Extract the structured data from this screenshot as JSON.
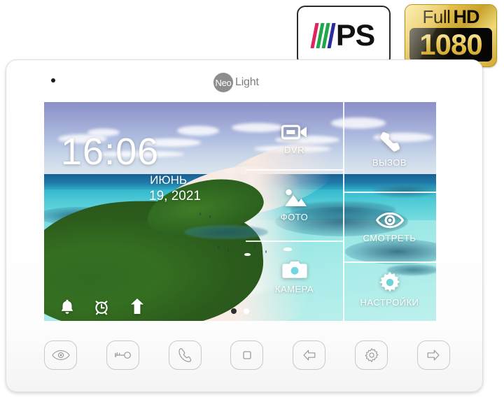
{
  "badges": {
    "ips": {
      "text": "PS",
      "bar_colors": [
        "#e0245e",
        "#1fa84a",
        "#1fa84a",
        "#2b2b9e"
      ],
      "name": "ips-badge"
    },
    "full_hd": {
      "full": "Full",
      "hd": "HD",
      "resolution": "1080",
      "gold": "#e8c552"
    }
  },
  "device": {
    "brand_mark": "Neo",
    "brand_word": "Light"
  },
  "screen": {
    "clock": {
      "time": "16:06",
      "month": "ИЮНЬ",
      "date": "19, 2021"
    },
    "status_icons": [
      {
        "name": "bell-icon",
        "label": "bell"
      },
      {
        "name": "alarm-clock-icon",
        "label": "alarm"
      },
      {
        "name": "upload-arrow-icon",
        "label": "upload"
      }
    ],
    "menu_tiles": [
      {
        "id": "dvr",
        "label": "DVR",
        "icon": "video-camera-icon"
      },
      {
        "id": "photo",
        "label": "ФОТО",
        "icon": "photo-icon"
      },
      {
        "id": "camera",
        "label": "КАМЕРА",
        "icon": "camera-icon"
      },
      {
        "id": "call",
        "label": "ВЫЗОВ",
        "icon": "phone-icon"
      },
      {
        "id": "watch",
        "label": "СМОТРЕТЬ",
        "icon": "eye-icon"
      },
      {
        "id": "settings",
        "label": "НАСТРОЙКИ",
        "icon": "gear-icon"
      }
    ],
    "pager": {
      "total": 2,
      "active": 2
    }
  },
  "touch_buttons": [
    {
      "id": "monitor",
      "icon": "eye-icon",
      "label": "Monitor"
    },
    {
      "id": "unlock",
      "icon": "key-icon",
      "label": "Unlock"
    },
    {
      "id": "talk",
      "icon": "phone-handset-icon",
      "label": "Talk"
    },
    {
      "id": "stop",
      "icon": "square-stop-icon",
      "label": "Stop"
    },
    {
      "id": "back",
      "icon": "arrow-left-icon",
      "label": "Back"
    },
    {
      "id": "settings",
      "icon": "gear-icon",
      "label": "Settings"
    },
    {
      "id": "forward",
      "icon": "arrow-right-icon",
      "label": "Forward"
    }
  ]
}
